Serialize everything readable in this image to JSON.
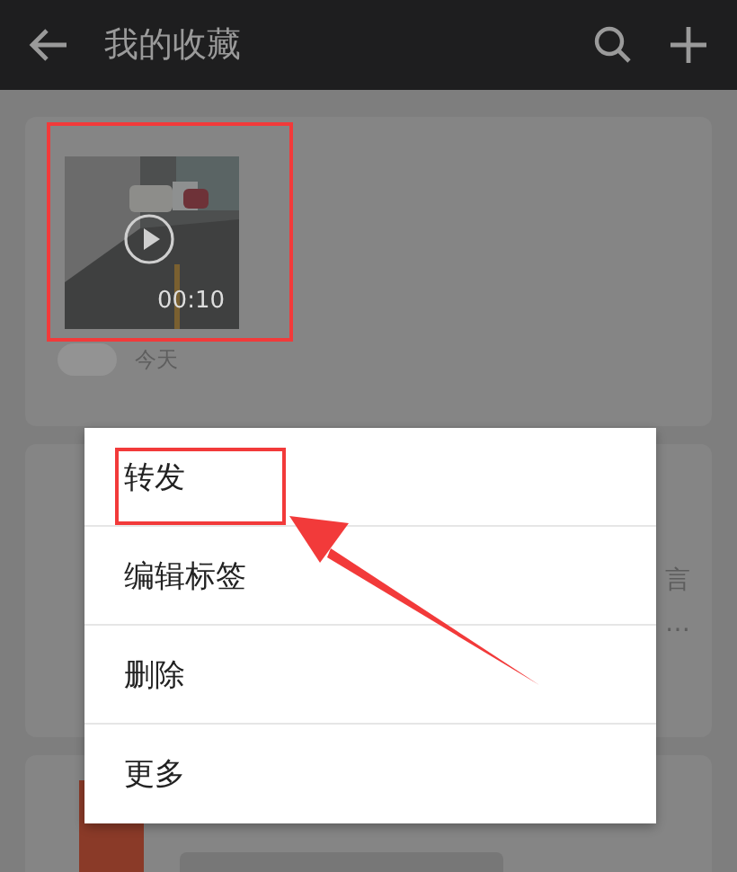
{
  "header": {
    "title": "我的收藏"
  },
  "video_card": {
    "duration": "00:10",
    "date": "今天"
  },
  "note_card": {
    "right_fragments": [
      "言",
      "…"
    ]
  },
  "menu": {
    "items": [
      {
        "label": "转发"
      },
      {
        "label": "编辑标签"
      },
      {
        "label": "删除"
      },
      {
        "label": "更多"
      }
    ]
  },
  "annotations": [
    {
      "kind": "box"
    },
    {
      "kind": "box"
    },
    {
      "kind": "arrow"
    }
  ]
}
